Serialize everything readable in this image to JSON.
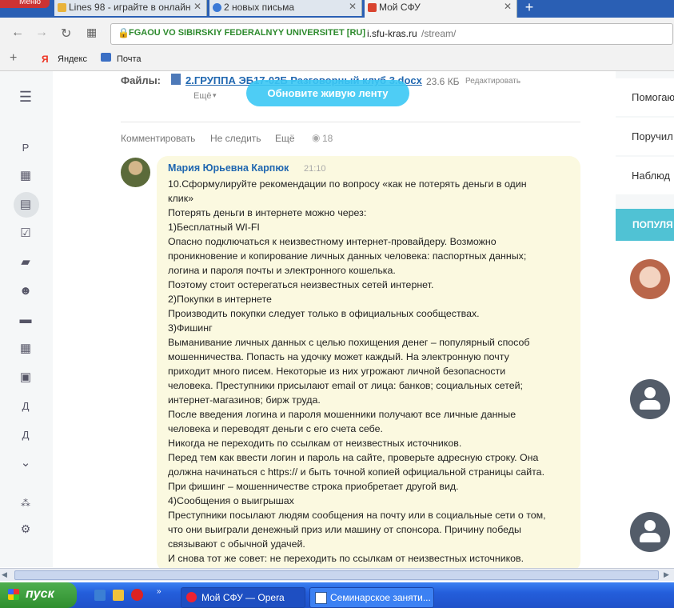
{
  "browser": {
    "opera_button": "Меню",
    "tabs": [
      {
        "label": "Lines 98 - играйте в онлайн"
      },
      {
        "label": "2 новых письма"
      },
      {
        "label": "Мой СФУ"
      }
    ],
    "new_tab": "+",
    "ssl_name": "FGAOU VO SIBIRSKIY FEDERALNYY UNIVERSITET [RU]",
    "url_domain": "i.sfu-kras.ru",
    "url_path": "/stream/",
    "bookmarks": [
      {
        "label": "Яндекс"
      },
      {
        "label": "Почта"
      }
    ]
  },
  "leftnav": {
    "letters": [
      "Р",
      "Д",
      "Д"
    ]
  },
  "post": {
    "files_label": "Файлы:",
    "file_name": "2.ГРУППА ЭБ17-02Б Разговорный клуб 3.docx",
    "file_size": "23.6 КБ",
    "edit_label": "Редактировать",
    "more_label": "Ещё",
    "refresh_button": "Обновите живую ленту",
    "actions": {
      "comment": "Комментировать",
      "unfollow": "Не следить",
      "more": "Ещё",
      "views": "18"
    }
  },
  "comment": {
    "author": "Мария Юрьевна Карпюк",
    "time": "21:10",
    "lines": [
      "10.Сформулируйте рекомендации по вопросу «как не потерять деньги в один",
      "клик»",
      "Потерять деньги в интернете можно через:",
      "1)Бесплатный WI-FI",
      "Опасно подключаться к неизвестному интернет-провайдеру. Возможно",
      "проникновение и копирование личных данных человека: паспортных данных;",
      "логина и пароля почты и электронного кошелька.",
      "Поэтому стоит остерегаться неизвестных сетей интернет.",
      "2)Покупки в интернете",
      "Производить покупки следует только в официальных сообществах.",
      "3)Фишинг",
      "Выманивание личных данных с целью похищения денег – популярный способ",
      "мошенничества. Попасть на удочку может каждый. На электронную почту",
      "приходит много писем. Некоторые из них угрожают личной безопасности",
      "человека. Преступники присылают email от лица: банков; социальных сетей;",
      "интернет-магазинов; бирж труда.",
      "После введения логина и пароля мошенники получают все личные данные",
      "человека и переводят деньги с его счета себе.",
      "Никогда не переходить по ссылкам от неизвестных источников.",
      "Перед тем как ввести логин и пароль на сайте, проверьте адресную строку. Она",
      "должна начинаться с https:// и быть точной копией официальной страницы сайта.",
      "При фишинг – мошенничестве строка приобретает другой вид.",
      "4)Сообщения о выигрышах",
      "Преступники посылают людям сообщения на почту или в социальные сети о том,",
      "что они выиграли денежный приз или машину от спонсора. Причину победы",
      "связывают с обычной удачей.",
      "И снова тот же совет: не переходить по ссылкам от неизвестных источников."
    ]
  },
  "rightcol": {
    "items": [
      {
        "label": "Помогаю"
      },
      {
        "label": "Поручил"
      },
      {
        "label": "Наблюд"
      }
    ],
    "popular": "ПОПУЛЯ"
  },
  "taskbar": {
    "start": "пуск",
    "tasks": [
      {
        "label": "Мой СФУ — Opera"
      },
      {
        "label": "Семинарское заняти..."
      }
    ]
  }
}
